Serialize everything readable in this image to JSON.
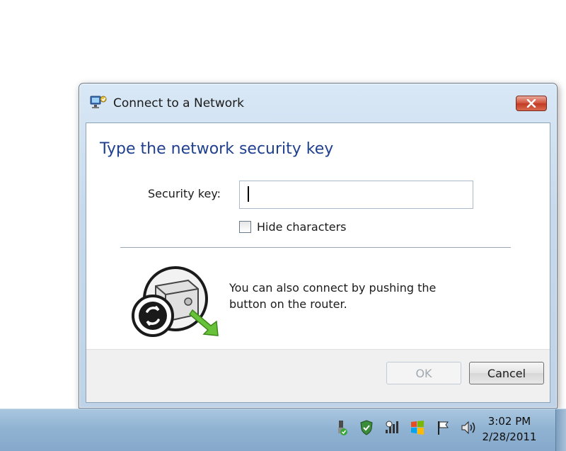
{
  "dialog": {
    "title": "Connect to a Network",
    "title_icon": "network-icon",
    "close_icon": "close-icon",
    "heading": "Type the network security key",
    "security_key_label": "Security key:",
    "security_key_value": "",
    "hide_characters_label": "Hide characters",
    "hide_characters_checked": false,
    "wps_text": "You can also connect by pushing the button on the router.",
    "ok_label": "OK",
    "ok_enabled": false,
    "cancel_label": "Cancel"
  },
  "taskbar": {
    "tray_icons": [
      "usb-icon",
      "security-shield-icon",
      "network-signal-icon",
      "windows-flag-icon",
      "action-center-flag-icon",
      "volume-icon"
    ],
    "time": "3:02 PM",
    "date": "2/28/2011"
  },
  "colors": {
    "heading": "#1f3f8f",
    "close_button": "#c13a22",
    "taskbar": "#8fb2d2",
    "wps_arrow": "#67c23a"
  }
}
